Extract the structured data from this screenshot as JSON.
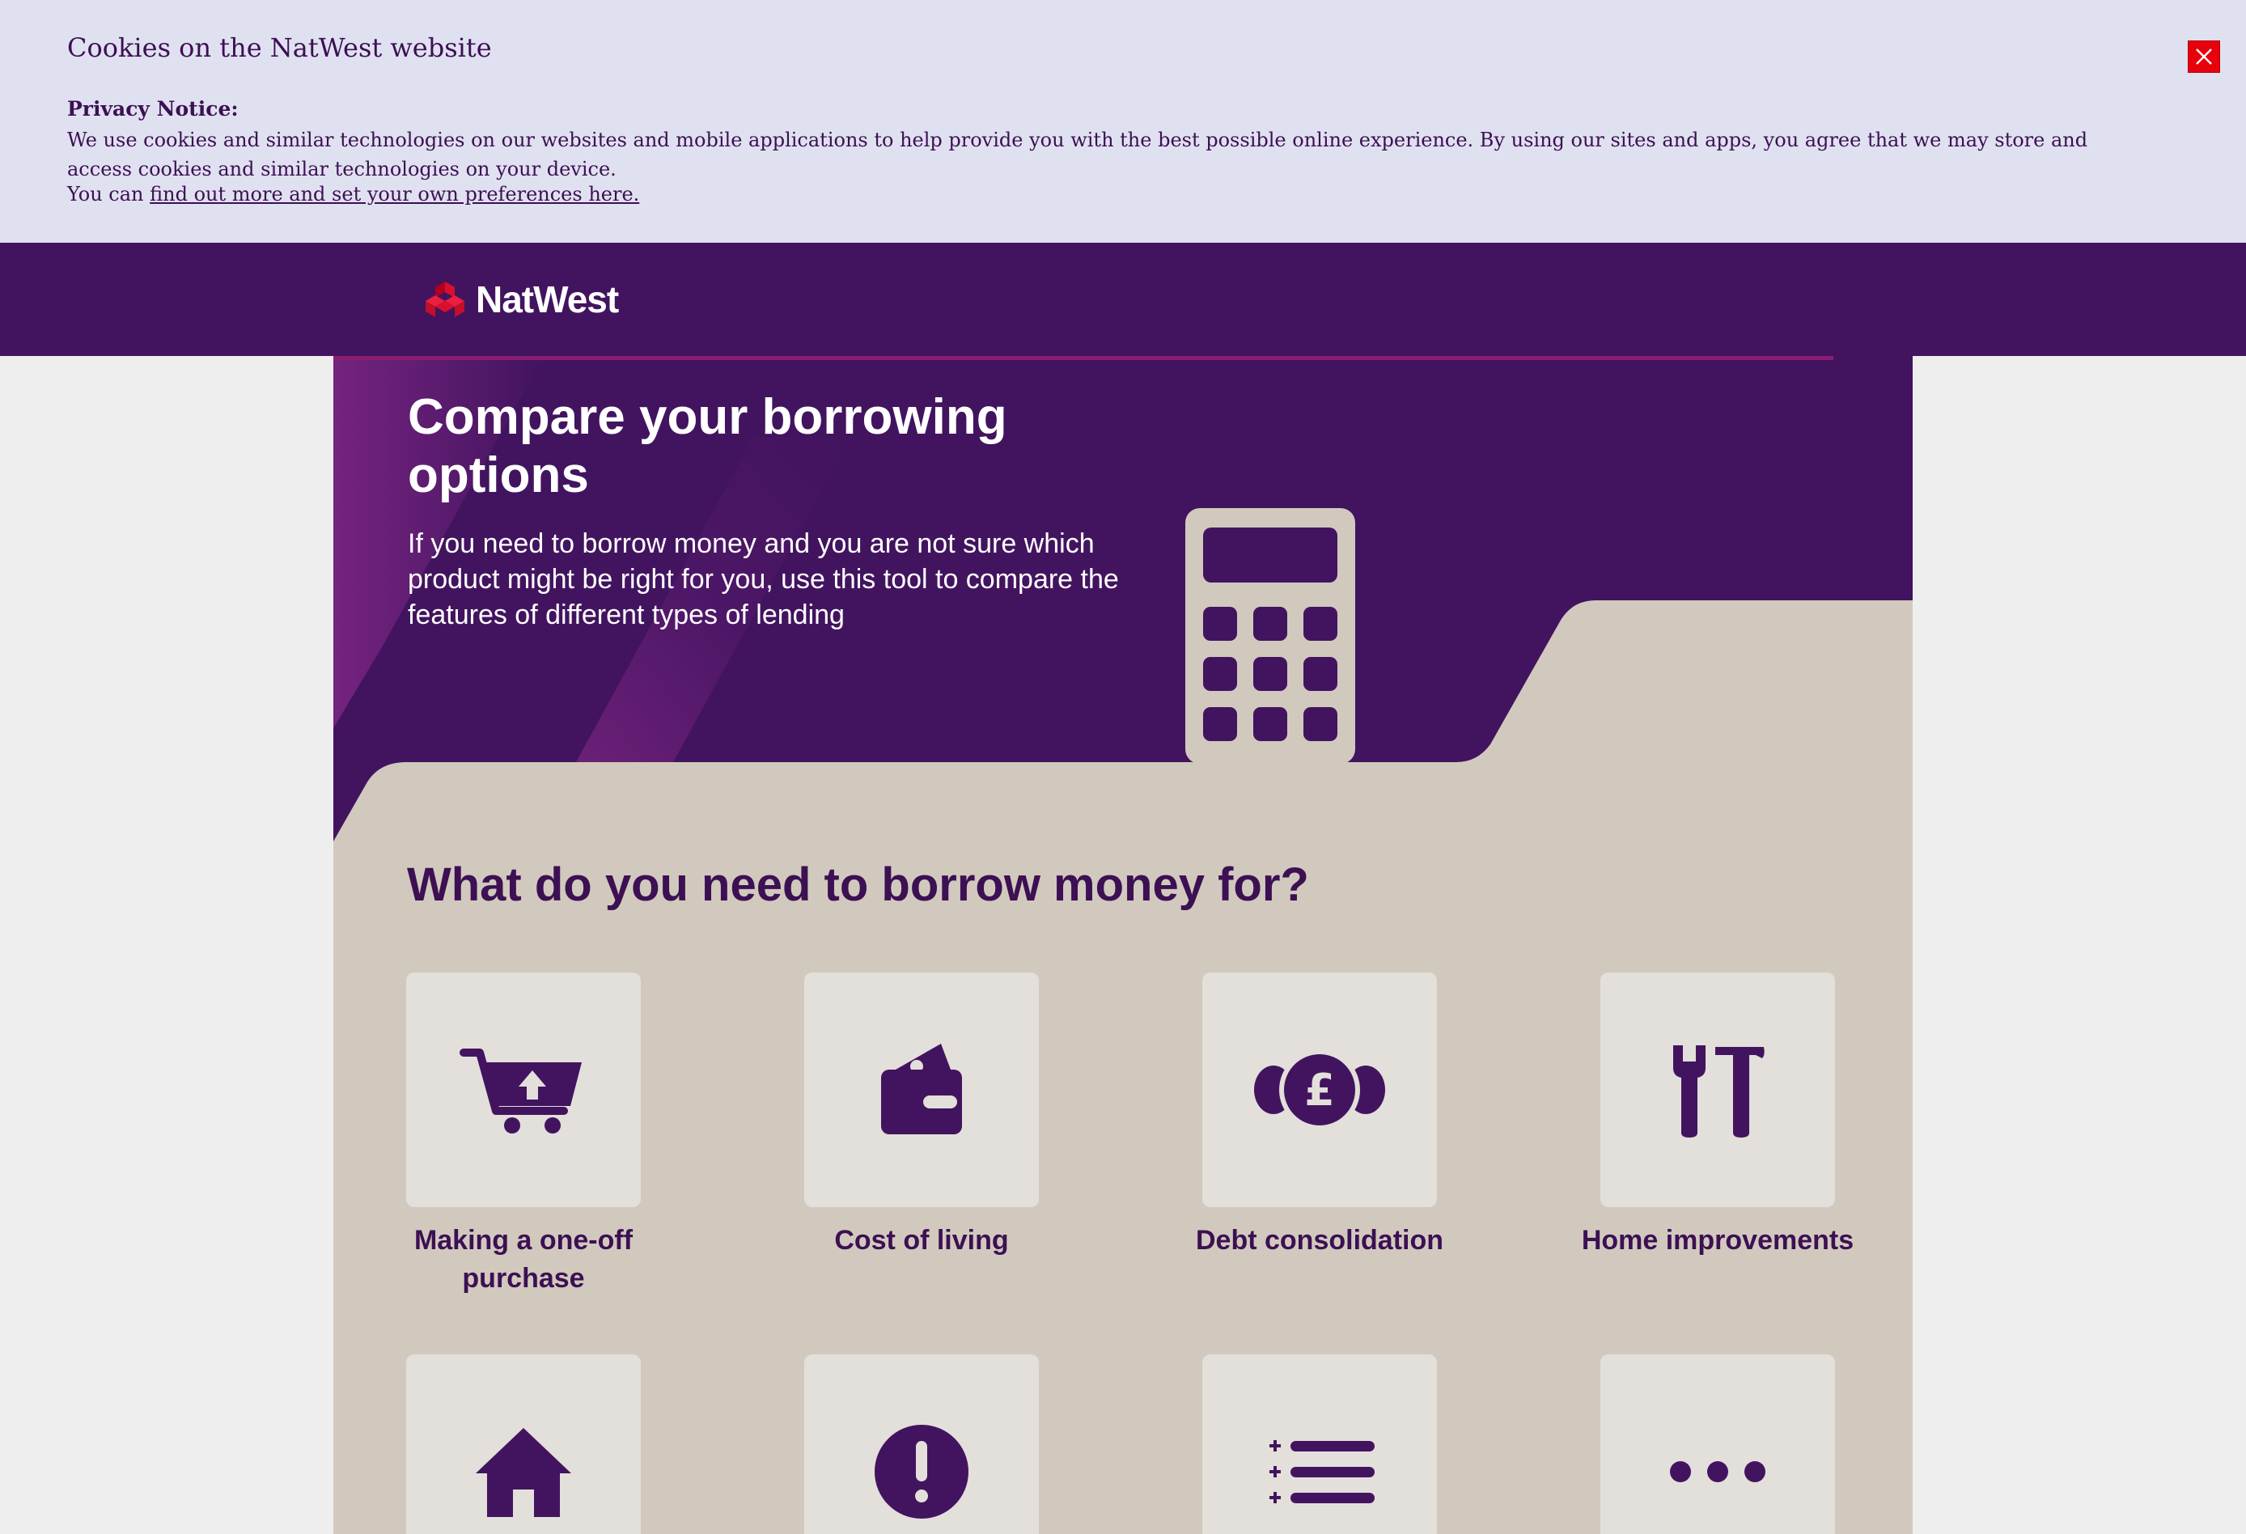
{
  "cookie_banner": {
    "title": "Cookies on the NatWest website",
    "notice_label": "Privacy Notice:",
    "body": "We use cookies and similar technologies on our websites and mobile applications to help provide you with the best possible online experience. By using our sites and apps, you agree that we may store and access cookies and similar technologies on your device.",
    "link_prefix": "You can ",
    "link_text": "find out more and set your own preferences here.",
    "close_icon": "close-icon",
    "close_color": "#e8000c"
  },
  "header": {
    "logo_text": "NatWest",
    "logo_icon": "natwest-cubes-icon",
    "brand_color": "#42145f"
  },
  "hero": {
    "title": "Compare your borrowing options",
    "subtitle": "If you need to borrow money and you are not sure which product might be right for you, use this tool to compare the features of different types of lending",
    "illustration": "calculator-icon"
  },
  "main": {
    "heading": "What do you need to borrow money for?",
    "options": [
      {
        "label": "Making a one-off purchase",
        "icon": "shopping-cart-icon"
      },
      {
        "label": "Cost of living",
        "icon": "wallet-icon"
      },
      {
        "label": "Debt consolidation",
        "icon": "pound-coins-icon"
      },
      {
        "label": "Home improvements",
        "icon": "tools-icon"
      },
      {
        "label": "",
        "icon": "house-icon"
      },
      {
        "label": "",
        "icon": "exclamation-icon"
      },
      {
        "label": "",
        "icon": "list-icon"
      },
      {
        "label": "",
        "icon": "more-icon"
      }
    ]
  },
  "colors": {
    "accent": "#3c1053",
    "panel": "#d2c9be",
    "tile": "#e3dfda",
    "banner": "#e0e1f0"
  }
}
